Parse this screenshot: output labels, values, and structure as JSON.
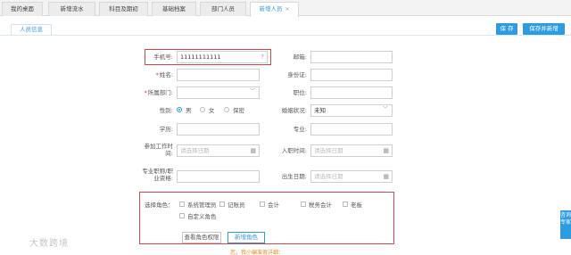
{
  "tabs": [
    "我的桌面",
    "新增流水",
    "科目及期初",
    "基础档案",
    "部门人员",
    "新增人员"
  ],
  "active_tab_close": "×",
  "subtab": "人员信息",
  "buttons": {
    "save": "保 存",
    "save_new": "保存并新增"
  },
  "form": {
    "phone_label": "手机号:",
    "phone_value": "11111111111",
    "email_label": "邮箱:",
    "name_label": "姓名:",
    "id_label": "身份证:",
    "dept_label": "所属部门:",
    "position_label": "职位:",
    "gender_label": "性别:",
    "gender_options": [
      "男",
      "女",
      "保密"
    ],
    "gender_selected": "男",
    "marital_label": "婚姻状况:",
    "marital_value": "未知",
    "education_label": "学历:",
    "major_label": "专业:",
    "worktime_label_1": "参加工作时",
    "worktime_label_2": "间:",
    "date_placeholder": "请选择日期",
    "hiredate_label": "入职时间:",
    "title_label_1": "专业职称/职",
    "title_label_2": "业资格:",
    "birth_label": "出生日期:"
  },
  "roles": {
    "label": "选择角色：",
    "options": [
      "系统管理员",
      "记账员",
      "会计",
      "税务会计",
      "老板",
      "自定义角色"
    ],
    "view_button": "查看角色权限",
    "add_button": "新增角色",
    "hint": "您，我小编准很详细："
  },
  "side_tab": "咨询专家",
  "watermark": "大数跨境",
  "icons": {
    "help": "?",
    "calendar": "▦",
    "chevron": "﹀"
  },
  "colors": {
    "accent": "#2c9be0",
    "highlight": "#d64646"
  }
}
